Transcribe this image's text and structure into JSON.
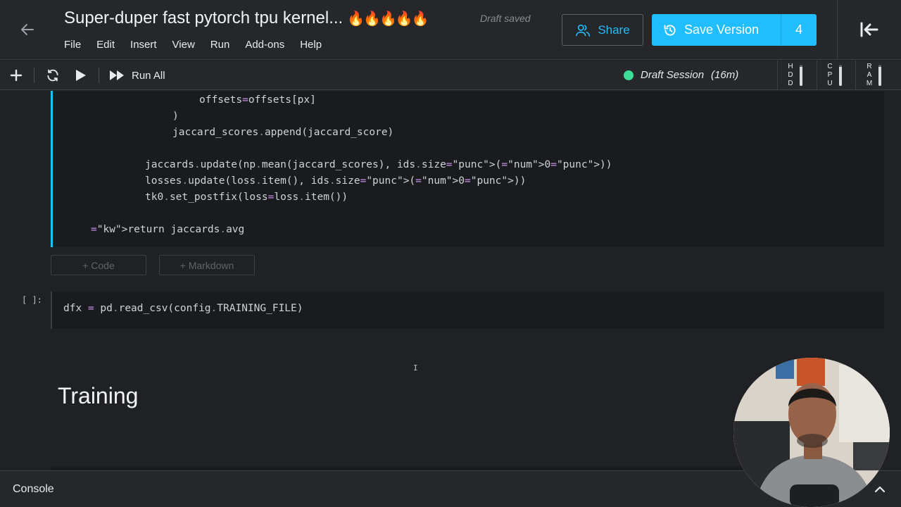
{
  "header": {
    "back_icon": "arrow-left-icon",
    "title": "Super-duper fast pytorch tpu kernel...",
    "title_emoji": "🔥🔥🔥🔥🔥",
    "draft_status": "Draft saved",
    "menu": [
      "File",
      "Edit",
      "Insert",
      "View",
      "Run",
      "Add-ons",
      "Help"
    ],
    "share_label": "Share",
    "save_version_label": "Save Version",
    "version_count": "4",
    "accent_color": "#20beff"
  },
  "toolbar": {
    "add_icon": "plus-icon",
    "refresh_icon": "refresh-icon",
    "run_icon": "play-icon",
    "run_all_label": "Run All",
    "session_label": "Draft Session",
    "session_time": "(16m)",
    "session_status_color": "#3ddc97",
    "meters": [
      {
        "name": "HDD",
        "letters": [
          "H",
          "D",
          "D"
        ],
        "level": 0.9
      },
      {
        "name": "CPU",
        "letters": [
          "C",
          "P",
          "U"
        ],
        "level": 0.9
      },
      {
        "name": "RAM",
        "letters": [
          "R",
          "A",
          "M"
        ],
        "level": 0.9
      }
    ]
  },
  "notebook": {
    "cell1_lines": [
      {
        "text": "offsets=offsets[px]"
      },
      {
        "text": ")"
      },
      {
        "text": "jaccard_scores.append(jaccard_score)"
      },
      {
        "text": "jaccards.update(np.mean(jaccard_scores), ids.size(0))"
      },
      {
        "text": "losses.update(loss.item(), ids.size(0))"
      },
      {
        "text": "tk0.set_postfix(loss=loss.item())"
      },
      {
        "text": "return jaccards.avg"
      }
    ],
    "add_code_label": "+ Code",
    "add_markdown_label": "+ Markdown",
    "cell2_prompt": "[ ]:",
    "cell2_code": "dfx = pd.read_csv(config.TRAINING_FILE)",
    "markdown_heading": "Training"
  },
  "console": {
    "label": "Console",
    "toggle_icon": "chevron-up-icon"
  }
}
